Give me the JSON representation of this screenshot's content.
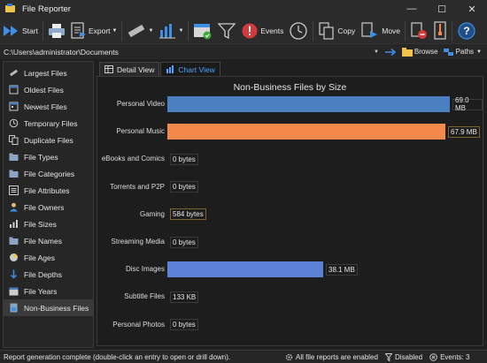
{
  "window": {
    "title": "File Reporter"
  },
  "toolbar": {
    "start": "Start",
    "export": "Export",
    "events": "Events",
    "copy": "Copy",
    "move": "Move"
  },
  "pathbar": {
    "path": "C:\\Users\\administrator\\Documents",
    "browse": "Browse",
    "paths": "Paths"
  },
  "sidebar": {
    "items": [
      {
        "label": "Largest Files",
        "icon": "largest-files-icon"
      },
      {
        "label": "Oldest Files",
        "icon": "oldest-files-icon"
      },
      {
        "label": "Newest Files",
        "icon": "newest-files-icon"
      },
      {
        "label": "Temporary Files",
        "icon": "temporary-files-icon"
      },
      {
        "label": "Duplicate Files",
        "icon": "duplicate-files-icon"
      },
      {
        "label": "File Types",
        "icon": "folder-icon"
      },
      {
        "label": "File Categories",
        "icon": "folder-icon"
      },
      {
        "label": "File Attributes",
        "icon": "attributes-icon"
      },
      {
        "label": "File Owners",
        "icon": "user-icon"
      },
      {
        "label": "File Sizes",
        "icon": "sizes-icon"
      },
      {
        "label": "File Names",
        "icon": "folder-icon"
      },
      {
        "label": "File Ages",
        "icon": "pie-icon"
      },
      {
        "label": "File Depths",
        "icon": "arrow-down-icon"
      },
      {
        "label": "File Years",
        "icon": "calendar-icon"
      },
      {
        "label": "Non-Business Files",
        "icon": "document-icon"
      }
    ]
  },
  "tabs": {
    "detail": "Detail View",
    "chart": "Chart View"
  },
  "chart_data": {
    "type": "bar",
    "orientation": "horizontal",
    "title": "Non-Business Files by Size",
    "categories": [
      "Personal Video",
      "Personal Music",
      "eBooks and Comics",
      "Torrents and P2P",
      "Gaming",
      "Streaming Media",
      "Disc Images",
      "Subtitle Files",
      "Personal Photos"
    ],
    "values": [
      69.0,
      67.9,
      0,
      0,
      0.000557,
      0,
      38.1,
      0.00013,
      0
    ],
    "unit": "MB",
    "labels": [
      "69.0 MB",
      "67.9 MB",
      "0 bytes",
      "0 bytes",
      "584 bytes",
      "0 bytes",
      "38.1 MB",
      "133 KB",
      "0 bytes"
    ],
    "colors": [
      "#4a7fc1",
      "#f2884a",
      "#4a7fc1",
      "#4a7fc1",
      "#4a7fc1",
      "#4a7fc1",
      "#5b82d6",
      "#4a7fc1",
      "#4a7fc1"
    ],
    "highlight": [
      false,
      true,
      false,
      false,
      true,
      false,
      false,
      false,
      false
    ],
    "xlim": [
      0,
      69.0
    ],
    "grid": false
  },
  "statusbar": {
    "message": "Report generation complete (double-click an entry to open or drill down).",
    "reports": "All file reports are enabled",
    "disabled": "Disabled",
    "events": "Events: 3"
  }
}
